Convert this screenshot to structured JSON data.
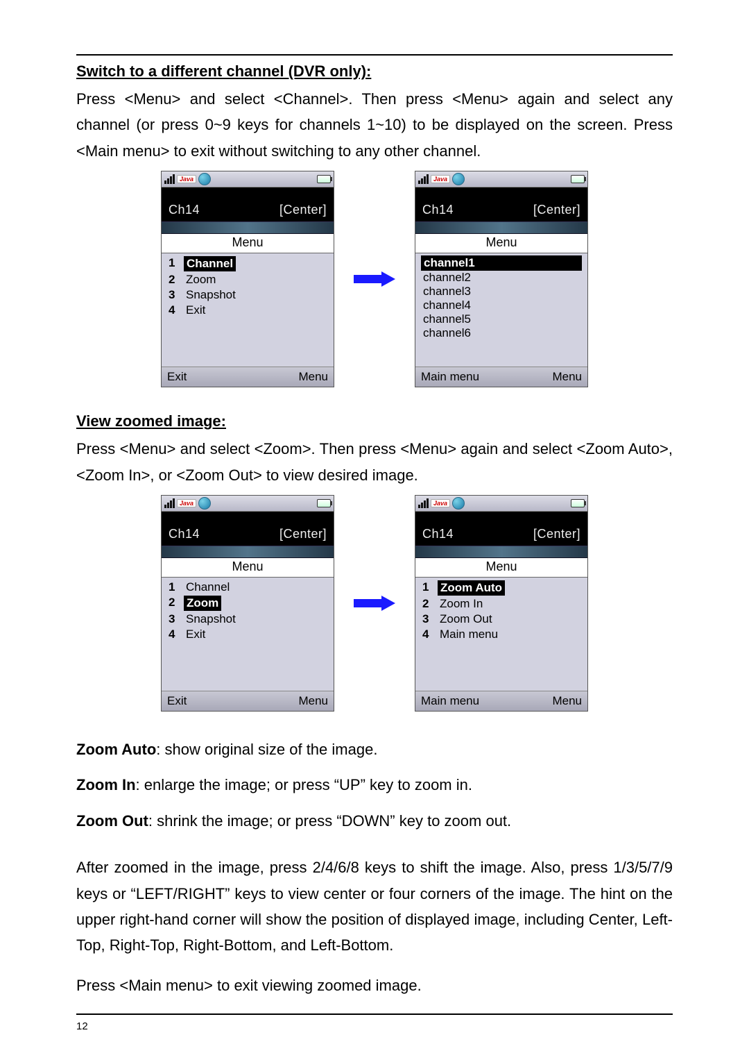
{
  "page_number": "12",
  "section1": {
    "heading": "Switch to a different channel (DVR only):",
    "para": "Press <Menu> and select <Channel>. Then press <Menu> again and select any channel (or press 0~9 keys for channels 1~10) to be displayed on the screen. Press <Main menu> to exit without switching to any other channel."
  },
  "section2": {
    "heading": "View zoomed image:",
    "para": "Press <Menu> and select <Zoom>. Then press <Menu> again and select <Zoom Auto>, <Zoom In>, or <Zoom Out> to view desired image."
  },
  "defs": {
    "auto_label": "Zoom Auto",
    "auto_text": ": show original size of the image.",
    "in_label": "Zoom In",
    "in_text": ": enlarge the image; or press “UP” key to zoom in.",
    "out_label": "Zoom Out",
    "out_text": ": shrink the image; or press “DOWN” key to zoom out."
  },
  "para_after_zoom": "After zoomed in the image, press 2/4/6/8 keys to shift the image. Also, press 1/3/5/7/9 keys or “LEFT/RIGHT” keys to view center or four corners of the image. The hint on the upper right-hand corner will show the position of displayed image, including Center, Left-Top, Right-Top, Right-Bottom, and Left-Bottom.",
  "para_exit_zoom": "Press <Main menu> to exit viewing zoomed image.",
  "status": {
    "java": "Java"
  },
  "phone_common": {
    "ch_label": "Ch14",
    "pos_label": "[Center]",
    "menu_title": "Menu"
  },
  "phone1": {
    "items": [
      {
        "num": "1",
        "label": "Channel",
        "selected": true
      },
      {
        "num": "2",
        "label": "Zoom"
      },
      {
        "num": "3",
        "label": "Snapshot"
      },
      {
        "num": "4",
        "label": "Exit"
      }
    ],
    "soft_left": "Exit",
    "soft_right": "Menu"
  },
  "phone2": {
    "items": [
      {
        "label": "channel1",
        "selected": true
      },
      {
        "label": "channel2"
      },
      {
        "label": "channel3"
      },
      {
        "label": "channel4"
      },
      {
        "label": "channel5"
      },
      {
        "label": "channel6"
      }
    ],
    "soft_left": "Main menu",
    "soft_right": "Menu"
  },
  "phone3": {
    "items": [
      {
        "num": "1",
        "label": "Channel"
      },
      {
        "num": "2",
        "label": "Zoom",
        "selected": true
      },
      {
        "num": "3",
        "label": "Snapshot"
      },
      {
        "num": "4",
        "label": "Exit"
      }
    ],
    "soft_left": "Exit",
    "soft_right": "Menu"
  },
  "phone4": {
    "items": [
      {
        "num": "1",
        "label": "Zoom Auto",
        "selected": true
      },
      {
        "num": "2",
        "label": "Zoom In"
      },
      {
        "num": "3",
        "label": "Zoom Out"
      },
      {
        "num": "4",
        "label": "Main menu"
      }
    ],
    "soft_left": "Main menu",
    "soft_right": "Menu"
  }
}
